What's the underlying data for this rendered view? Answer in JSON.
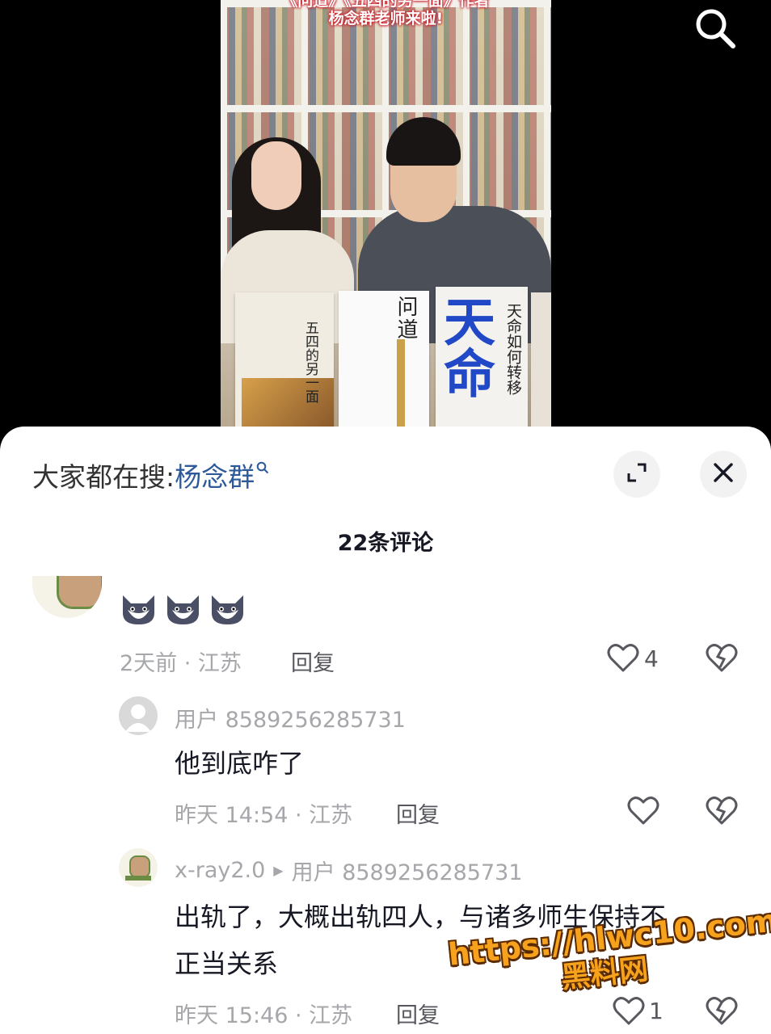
{
  "video": {
    "title_line1": "《问道》《五四的另一面》作者",
    "title_line2": "杨念群老师来啦!",
    "books": [
      {
        "title": "五四的另一面"
      },
      {
        "title": "问道"
      },
      {
        "title": "天命如何转移",
        "big": "天命"
      }
    ]
  },
  "sheet": {
    "search_prefix": "大家都在搜:",
    "search_keyword": "杨念群",
    "comment_count": "22条评论"
  },
  "comments": [
    {
      "emojis": [
        "dog",
        "dog",
        "dog"
      ],
      "time_loc": "2天前 · 江苏",
      "reply_label": "回复",
      "likes": "4"
    }
  ],
  "replies": [
    {
      "username": "用户 8589256285731",
      "text": "他到底咋了",
      "time_loc": "昨天 14:54 · 江苏",
      "reply_label": "回复",
      "likes": ""
    },
    {
      "username": "x-ray2.0",
      "reply_to": "用户 8589256285731",
      "text_line1": "出轨了，大概出轨四人，与诸多师生保持不",
      "text_line2": "正当关系",
      "time_loc": "昨天 15:46 · 江苏",
      "reply_label": "回复",
      "likes": "1"
    }
  ],
  "watermark": {
    "line1": "https://hlwc10.com",
    "line2": "黑料网"
  },
  "icons": {
    "search": "search-icon",
    "expand": "expand-icon",
    "close": "close-icon",
    "like": "heart-icon",
    "dislike": "broken-heart-icon"
  },
  "colors": {
    "keyword": "#2e5a99",
    "meta": "#a6a7ab",
    "watermark": "#f6a21c"
  }
}
